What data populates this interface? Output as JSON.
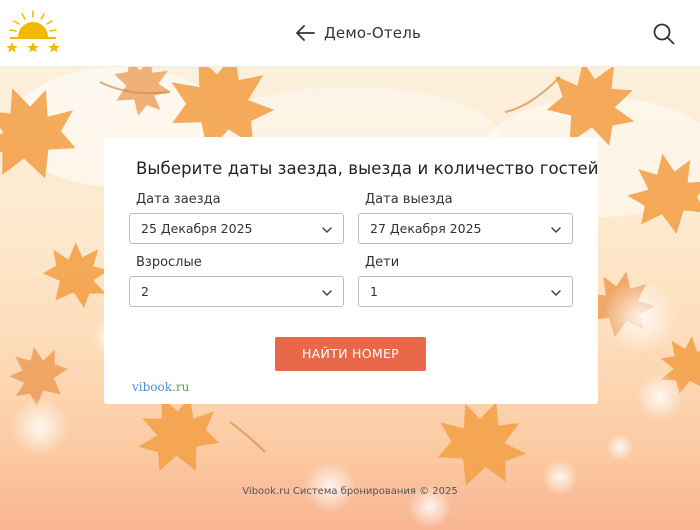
{
  "header": {
    "logo_icon": "sun-with-stars-icon",
    "back_icon": "arrow-left-icon",
    "hotel_name": "Демо-Отель",
    "search_icon": "search-icon"
  },
  "form": {
    "title": "Выберите даты заезда, выезда и количество гостей",
    "checkin": {
      "label": "Дата заезда",
      "value": "25 Декабря 2025"
    },
    "checkout": {
      "label": "Дата выезда",
      "value": "27 Декабря 2025"
    },
    "adults": {
      "label": "Взрослые",
      "value": "2"
    },
    "children": {
      "label": "Дети",
      "value": "1"
    },
    "submit_label": "НАЙТИ НОМЕР"
  },
  "brand": {
    "part1": "vibook",
    "part2": ".ru"
  },
  "footer": {
    "text": "Vibook.ru Система бронирования © 2025"
  },
  "colors": {
    "accent_button": "#e8694a",
    "logo_sun": "#f5b800",
    "brand_blue": "#4b8fd1",
    "brand_green": "#58a841"
  }
}
